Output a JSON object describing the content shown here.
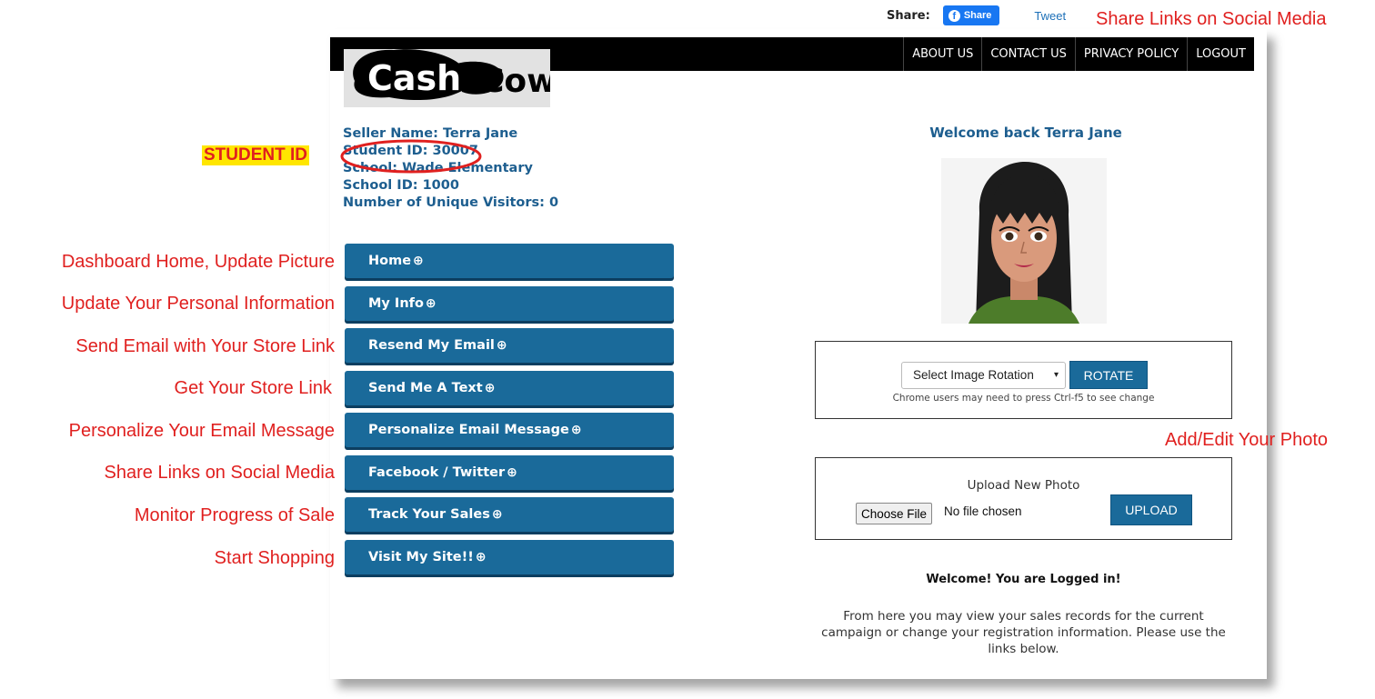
{
  "share": {
    "label": "Share:",
    "facebook_button": "Share",
    "facebook_icon": "facebook-f-icon",
    "tweet": "Tweet"
  },
  "nav": {
    "items": [
      "ABOUT US",
      "CONTACT US",
      "PRIVACY POLICY",
      "LOGOUT"
    ]
  },
  "logo": {
    "text": "CashCow"
  },
  "seller": {
    "name": "Seller Name: Terra Jane",
    "student_id": "Student ID: 30007",
    "school": "School: Wade Elementary",
    "school_id": "School ID: 1000",
    "visitors": "Number of Unique Visitors: 0"
  },
  "sidebar": {
    "arrow_icon": "circle-arrow-right-icon",
    "items": [
      {
        "label": "Home"
      },
      {
        "label": "My Info"
      },
      {
        "label": "Resend My Email"
      },
      {
        "label": "Send Me A Text"
      },
      {
        "label": "Personalize Email Message"
      },
      {
        "label": "Facebook / Twitter"
      },
      {
        "label": "Track Your Sales"
      },
      {
        "label": "Visit My Site!!"
      }
    ]
  },
  "main": {
    "welcome": "Welcome back Terra Jane",
    "rotation": {
      "select_value": "Select Image Rotation",
      "button": "ROTATE",
      "note": "Chrome users may need to press Ctrl-f5 to see change"
    },
    "upload": {
      "title": "Upload New Photo",
      "choose_file": "Choose File",
      "no_file": "No file chosen",
      "button": "UPLOAD"
    },
    "logged_in_title": "Welcome! You are Logged in!",
    "logged_in_text": "From here you may view your sales records for the current campaign or change your registration information. Please use the links below."
  },
  "annotations": {
    "share_links": "Share Links on Social Media",
    "student_id_tag": "STUDENT ID",
    "add_edit_photo": "Add/Edit Your Photo",
    "left": [
      "Dashboard Home, Update Picture",
      "Update Your Personal Information",
      "Send Email with Your Store Link",
      "Get Your Store Link",
      "Personalize Your Email Message",
      "Share Links on Social Media",
      "Monitor Progress of Sale",
      "Start Shopping"
    ]
  },
  "colors": {
    "accent_blue": "#1a6a9a",
    "heading_blue": "#1d5e8f",
    "annotation_red": "#e0201f",
    "highlight_yellow": "#ffe600",
    "facebook_blue": "#1877f2"
  }
}
